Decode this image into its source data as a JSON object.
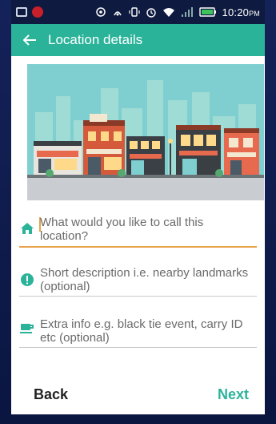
{
  "status_bar": {
    "time": "10:20",
    "ampm": "PM",
    "icons": [
      "keyboard-icon",
      "alert-icon",
      "location-icon",
      "nfc-icon",
      "vibrate-icon",
      "alarm-icon",
      "wifi-icon",
      "signal-icon",
      "battery-icon"
    ]
  },
  "app_bar": {
    "title": "Location details",
    "back_icon": "back-arrow-icon"
  },
  "illustration": {
    "shop_sign": ""
  },
  "form": {
    "name_field": {
      "placeholder": "What would you like to call this location?",
      "icon": "home-icon"
    },
    "description_field": {
      "placeholder": "Short description i.e. nearby landmarks (optional)",
      "icon": "info-icon"
    },
    "extra_field": {
      "placeholder": "Extra info e.g. black tie event, carry ID etc (optional)",
      "icon": "coffee-icon"
    }
  },
  "footer": {
    "back_label": "Back",
    "next_label": "Next"
  },
  "colors": {
    "accent": "#2bb39a",
    "active_underline": "#e8a24a",
    "status_bar": "#0e1a3f"
  }
}
